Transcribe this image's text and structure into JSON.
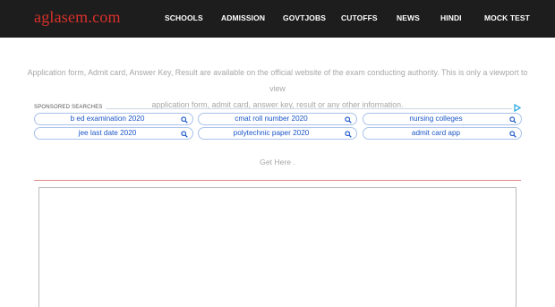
{
  "header": {
    "logo": "aglasem.com",
    "nav": [
      {
        "label": "SCHOOLS"
      },
      {
        "label": "ADMISSION"
      },
      {
        "label": "GOVTJOBS"
      },
      {
        "label": "CUTOFFS"
      },
      {
        "label": "NEWS"
      },
      {
        "label": "HINDI"
      },
      {
        "label": "MOCK TEST"
      }
    ]
  },
  "info": {
    "line1": "Application form, Admit card, Answer Key, Result are available on the official website of the exam conducting authority. This is only a viewport to view",
    "line2": "application form, admit card, answer key, result or any other information."
  },
  "sponsored": {
    "label": "SPONSORED SEARCHES",
    "searches": [
      {
        "label": "b ed examination 2020"
      },
      {
        "label": "cmat roll number 2020"
      },
      {
        "label": "nursing colleges"
      },
      {
        "label": "jee last date 2020"
      },
      {
        "label": "polytechnic paper 2020"
      },
      {
        "label": "admit card app"
      }
    ]
  },
  "get_here": "Get Here .",
  "colors": {
    "topbar": "#1d1d1d",
    "logo": "#d9312b",
    "link": "#1a55c8",
    "divider": "#e48a8a"
  }
}
